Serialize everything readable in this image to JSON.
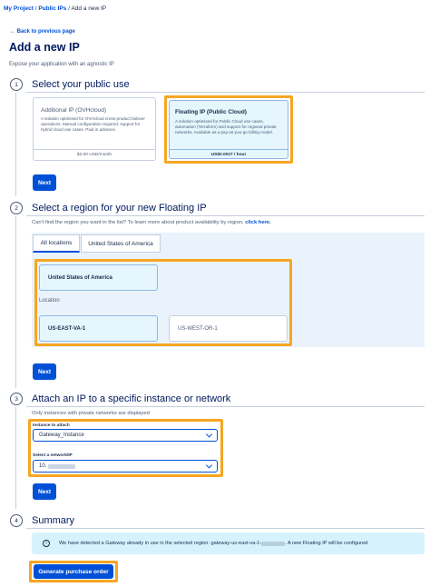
{
  "breadcrumb": {
    "project": "My Project",
    "sep": "/",
    "public_ips": "Public IPs",
    "current": "Add a new IP"
  },
  "back_link": "← Back to previous page",
  "page_title": "Add a new IP",
  "page_subtitle": "Expose your application with an agnostic IP",
  "step1": {
    "number": "1",
    "title": "Select your public use",
    "cards": [
      {
        "title": "Additional IP (OVHcloud)",
        "description": "A solution optimised for OVHcloud cross-product failover operations. Manual configuration required; support for hybrid cloud use cases. Paid in advance.",
        "price": "$2.00 USD/month"
      },
      {
        "title": "Floating IP (Public Cloud)",
        "description": "A solution optimised for Public Cloud use cases, automation (Terraform) and support for regional private networks. Available as a pay-as-you-go billing model.",
        "price": "US$0.0027 / hour"
      }
    ],
    "next_label": "Next"
  },
  "step2": {
    "number": "2",
    "title": "Select a region for your new Floating IP",
    "hint_text": "Can't find the region you want in the list? To learn more about product availability by region,",
    "hint_link": "click here.",
    "tabs": [
      "All locations",
      "United States of America"
    ],
    "country_tile": "United States of America",
    "location_label": "Location",
    "regions": [
      "US-EAST-VA-1",
      "US-WEST-OR-1"
    ],
    "next_label": "Next"
  },
  "step3": {
    "number": "3",
    "title": "Attach an IP to a specific instance or network",
    "hint": "Only instances with private networks are displayed",
    "instance_label": "Instance to attach",
    "instance_value": "Gateway_Instance",
    "network_label": "Select a network/IP",
    "network_value": "10.",
    "next_label": "Next"
  },
  "step4": {
    "number": "4",
    "title": "Summary",
    "info_icon": "i",
    "info_prefix": "We have detected a Gateway already in use in the selected region: gateway-us-east-va-1-",
    "info_suffix": ". A new Floating IP will be configured.",
    "generate_label": "Generate purchase order"
  },
  "colors": {
    "accent": "#0050d7",
    "highlight": "#f6a623",
    "title": "#00185e",
    "selected_bg": "#e5f6fd"
  }
}
